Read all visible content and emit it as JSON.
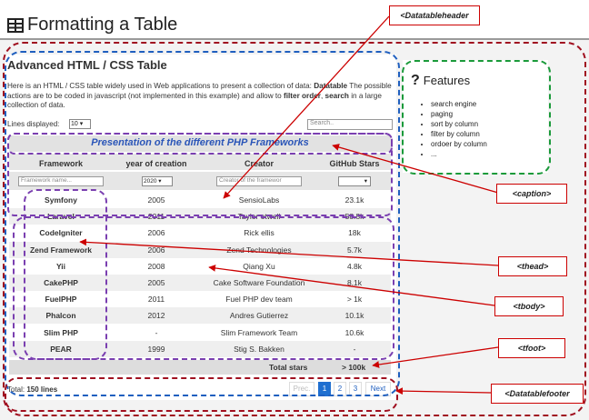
{
  "header": {
    "title": "Formatting a Table",
    "icon": "table-icon"
  },
  "main": {
    "title": "Advanced HTML / CSS Table",
    "description_parts": {
      "p1": "Here is an HTML / CSS table widely used in Web applications to present a collection of data: ",
      "b1": "Datatable",
      "p2": " The possible actions are to be coded in javascript (not implemented in this example) and allow to ",
      "b2": "filter order",
      "p3": ", ",
      "b3": "search",
      "p4": " in a large collection of data."
    },
    "lines_label": "Lines displayed:",
    "lines_value": "10",
    "search_placeholder": "Search..",
    "caption": "Presentation of the different PHP Frameworks",
    "columns": [
      "Framework",
      "year of creation",
      "Creator",
      "GitHub Stars"
    ],
    "filters": {
      "framework_placeholder": "Framework name...",
      "year_value": "2020",
      "creator_placeholder": "Creator of the framewor",
      "stars_value": ""
    },
    "rows": [
      [
        "Symfony",
        "2005",
        "SensioLabs",
        "23.1k"
      ],
      [
        "Laravel",
        "2011",
        "Taylor otwell",
        "58.8k"
      ],
      [
        "CodeIgniter",
        "2006",
        "Rick ellis",
        "18k"
      ],
      [
        "Zend Framework",
        "2006",
        "Zend Technologies",
        "5.7k"
      ],
      [
        "Yii",
        "2008",
        "Qiang Xu",
        "4.8k"
      ],
      [
        "CakePHP",
        "2005",
        "Cake Software Foundation",
        "8.1k"
      ],
      [
        "FuelPHP",
        "2011",
        "Fuel PHP dev team",
        "> 1k"
      ],
      [
        "Phalcon",
        "2012",
        "Andres Gutierrez",
        "10.1k"
      ],
      [
        "Slim PHP",
        "-",
        "Slim Framework Team",
        "10.6k"
      ],
      [
        "PEAR",
        "1999",
        "Stig S. Bakken",
        "-"
      ]
    ],
    "tfoot": {
      "label": "Total stars",
      "value": "> 100k"
    },
    "footer": {
      "total_prefix": "Total: ",
      "total_value": "150 lines"
    },
    "pagination": [
      "Prec.",
      "1",
      "2",
      "3",
      "Next"
    ]
  },
  "features": {
    "title": "Features",
    "items": [
      "search engine",
      "paging",
      "sort by column",
      "filter by column",
      "ordoer by column",
      "..."
    ]
  },
  "callouts": {
    "datatableheader": "<Datatableheader",
    "caption": "<caption>",
    "thead": "<thead>",
    "tbody": "<tbody>",
    "tfoot": "<tfoot>",
    "datatablefooter": "<Datatablefooter"
  },
  "colors": {
    "accent": "#1f6fd0",
    "caption": "#2a55b8",
    "annotation_red": "#cc0000",
    "outer_dash": "#a01020",
    "blue_dash": "#1f5fbf",
    "green_dash": "#1a9a3a",
    "purple_dash": "#7a3fb0"
  }
}
